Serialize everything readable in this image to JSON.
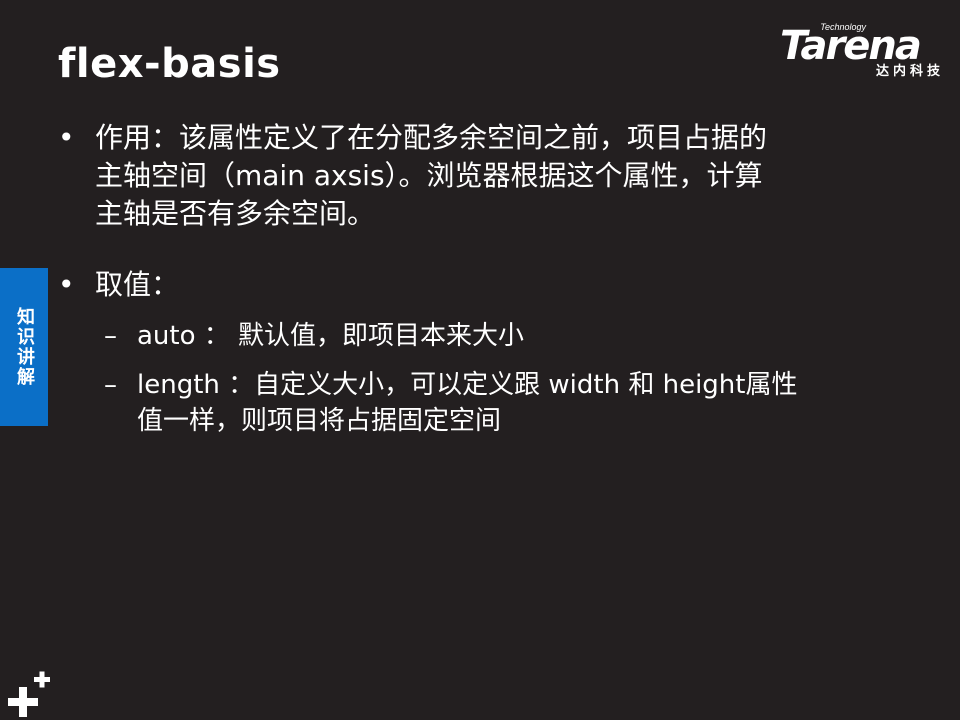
{
  "slide": {
    "title": "flex-basis",
    "side_tab": "知识讲解"
  },
  "logo": {
    "technology": "Technology",
    "brand": "Tarena",
    "chinese": "达内科技"
  },
  "bullets": [
    {
      "marker": "•",
      "lines": [
        "作用：该属性定义了在分配多余空间之前，项目占据的",
        "主轴空间（main axsis）。浏览器根据这个属性，计算",
        "主轴是否有多余空间。"
      ]
    },
    {
      "marker": "•",
      "lines": [
        "取值："
      ]
    }
  ],
  "subbullets": [
    {
      "marker": "–",
      "lines": [
        "auto ： 默认值，即项目本来大小"
      ]
    },
    {
      "marker": "–",
      "lines": [
        "length ：自定义大小，可以定义跟 width 和 height属性",
        "值一样，则项目将占据固定空间"
      ]
    }
  ]
}
